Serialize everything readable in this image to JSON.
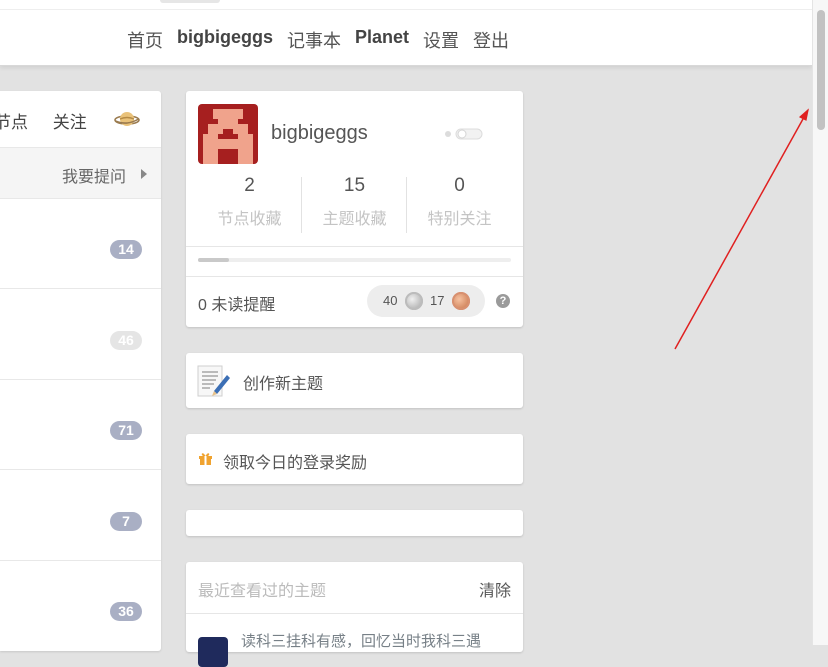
{
  "nav": {
    "items": [
      {
        "label": "首页",
        "strong": false
      },
      {
        "label": "bigbigeggs",
        "strong": true
      },
      {
        "label": "记事本",
        "strong": false
      },
      {
        "label": "Planet",
        "strong": true
      },
      {
        "label": "设置",
        "strong": false
      },
      {
        "label": "登出",
        "strong": false
      }
    ]
  },
  "left_panel": {
    "tabs": [
      "节点",
      "关注"
    ],
    "ask_label": "我要提问",
    "topic_reply_counts": [
      "14",
      "46",
      "71",
      "7",
      "36"
    ]
  },
  "profile": {
    "username": "bigbigeggs",
    "stats": [
      {
        "value": "2",
        "label": "节点收藏"
      },
      {
        "value": "15",
        "label": "主题收藏"
      },
      {
        "value": "0",
        "label": "特别关注"
      }
    ],
    "progress_fraction": 0.1,
    "unread": "0 未读提醒",
    "silver": "40",
    "bronze": "17",
    "help": "?"
  },
  "create_topic": {
    "label": "创作新主题"
  },
  "daily_reward": {
    "label": "领取今日的登录奖励"
  },
  "recent": {
    "title": "最近查看过的主题",
    "clear": "清除",
    "first_item_title": "读科三挂科有感，回忆当时我科三遇"
  },
  "colors": {
    "badge": "#a9afc4",
    "badge_light": "#e5e5e5",
    "avatar_red": "#a61f1f",
    "gift": "#f0a330",
    "annotation_arrow": "#e02020"
  }
}
